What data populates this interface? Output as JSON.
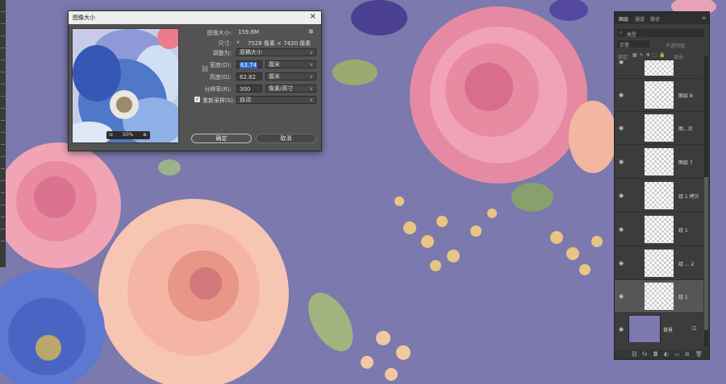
{
  "dialog": {
    "title": "图像大小",
    "close": "×",
    "image_size_label": "图像大小:",
    "image_size_value": "159.8M",
    "settings_icon": "gear-icon",
    "dimensions_label": "尺寸:",
    "dimensions_value": "7528 像素 × 7420 像素",
    "fit_label": "调整为:",
    "fit_value": "原稿大小",
    "width_label": "宽度(D):",
    "width_value": "63.74",
    "width_unit": "厘米",
    "height_label": "高度(G):",
    "height_value": "62.82",
    "height_unit": "厘米",
    "resolution_label": "分辨率(R):",
    "resolution_value": "300",
    "resolution_unit": "像素/英寸",
    "resample_label": "重新采样(S):",
    "resample_value": "自动",
    "zoom_value": "50%",
    "ok_label": "确定",
    "cancel_label": "取消"
  },
  "layers_panel": {
    "tabs": [
      "图层",
      "通道",
      "路径"
    ],
    "active_tab": "图层",
    "filter_label": "类型",
    "blend_mode": "正常",
    "opacity_label": "不透明度:",
    "lock_label": "锁定:",
    "fill_label": "填充:",
    "layers": [
      {
        "name": "",
        "visible": true
      },
      {
        "name": "图层 8",
        "visible": true
      },
      {
        "name": "图...贝",
        "visible": true
      },
      {
        "name": "图层 7",
        "visible": true
      },
      {
        "name": "组 1 拷贝",
        "visible": true
      },
      {
        "name": "组 1",
        "visible": true
      },
      {
        "name": "组 ... 2",
        "visible": true
      },
      {
        "name": "组 1",
        "visible": true,
        "active": true
      },
      {
        "name": "背景",
        "visible": true,
        "locked": true
      }
    ],
    "footer_icons": [
      "link-icon",
      "fx-icon",
      "mask-icon",
      "adjustment-icon",
      "folder-icon",
      "new-layer-icon",
      "trash-icon"
    ]
  },
  "colors": {
    "canvas_bg": "#7b79ad",
    "dialog_bg": "#535353",
    "panel_bg": "#3c3c3c",
    "selection": "#2d6bd0"
  }
}
